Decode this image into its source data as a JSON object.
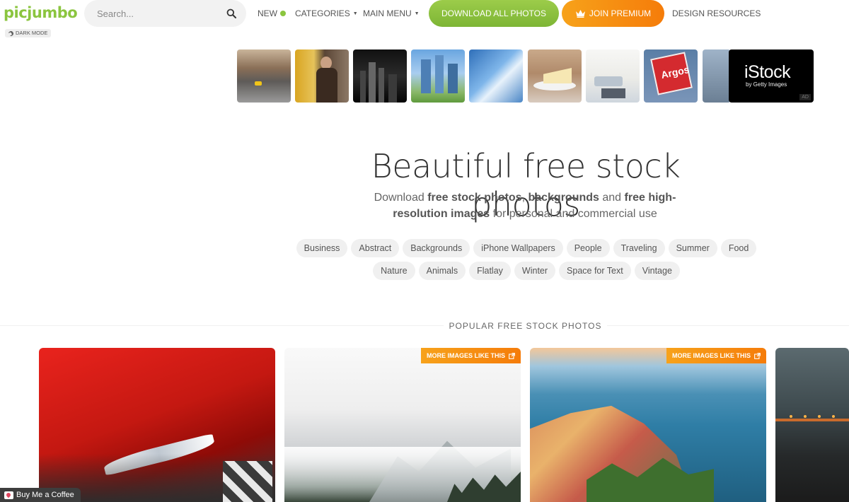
{
  "header": {
    "logo": "picjumbo",
    "dark_mode_label": "DARK MODE",
    "search_placeholder": "Search...",
    "nav": {
      "new": "NEW",
      "categories": "CATEGORIES",
      "main_menu": "MAIN MENU",
      "download_all": "DOWNLOAD ALL PHOTOS",
      "join_premium": "JOIN PREMIUM",
      "design_resources": "DESIGN RESOURCES"
    },
    "colors": {
      "brand_green": "#8bc53f",
      "premium_orange": "#f57c0a"
    }
  },
  "ad_strip": {
    "thumbnails": [
      {
        "icon": "city-street-photo"
      },
      {
        "icon": "woman-in-city-photo"
      },
      {
        "icon": "night-skyline-photo"
      },
      {
        "icon": "skyscrapers-park-photo"
      },
      {
        "icon": "glass-towers-photo"
      },
      {
        "icon": "cheesecake-photo"
      },
      {
        "icon": "living-room-photo"
      },
      {
        "icon": "argos-sign-photo"
      },
      {
        "icon": "building-railing-photo"
      }
    ],
    "advertiser": {
      "logo": "iStock",
      "sub": "by Getty Images",
      "badge": "AD"
    }
  },
  "hero": {
    "title": "Beautiful free stock photos",
    "subtitle_parts": [
      {
        "text": "Download ",
        "bold": false
      },
      {
        "text": "free stock photos",
        "bold": true
      },
      {
        "text": ", ",
        "bold": false
      },
      {
        "text": "backgrounds",
        "bold": true
      },
      {
        "text": " and ",
        "bold": false
      },
      {
        "text": "free high-resolution images",
        "bold": true
      },
      {
        "text": " for personal and commercial use",
        "bold": false
      }
    ]
  },
  "tags": [
    "Business",
    "Abstract",
    "Backgrounds",
    "iPhone Wallpapers",
    "People",
    "Traveling",
    "Summer",
    "Food",
    "Nature",
    "Animals",
    "Flatlay",
    "Winter",
    "Space for Text",
    "Vintage"
  ],
  "popular": {
    "section_title": "POPULAR FREE STOCK PHOTOS",
    "cards": [
      {
        "icon": "red-car-headlight-photo",
        "badge": ""
      },
      {
        "icon": "foggy-mountains-photo",
        "badge": "MORE IMAGES LIKE THIS"
      },
      {
        "icon": "coastal-village-photo",
        "badge": "MORE IMAGES LIKE THIS"
      },
      {
        "icon": "bridge-night-photo",
        "badge": ""
      }
    ]
  },
  "footer_widget": {
    "coffee_label": "Buy Me a Coffee"
  }
}
